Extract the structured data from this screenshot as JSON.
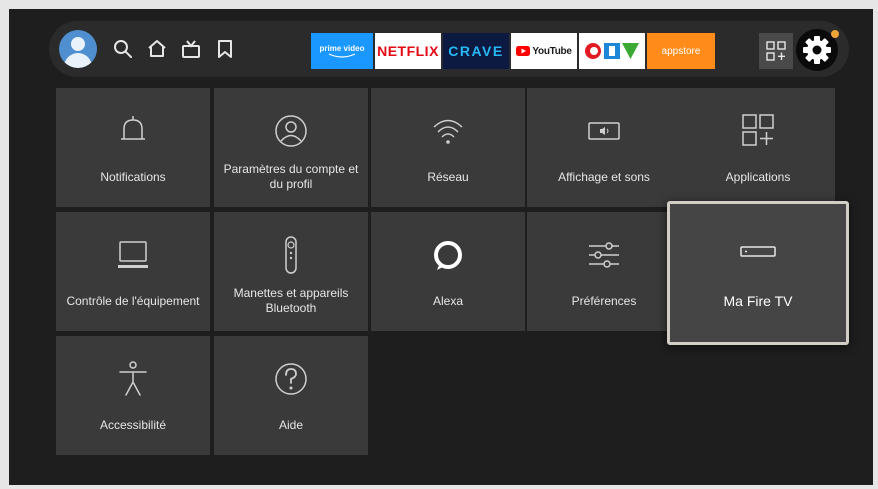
{
  "top_bar": {
    "apps": [
      {
        "id": "prime-video",
        "label": "prime video",
        "bg": "#1a98ff",
        "fg": "#ffffff"
      },
      {
        "id": "netflix",
        "label": "NETFLIX",
        "bg": "#ffffff",
        "fg": "#e50914"
      },
      {
        "id": "crave",
        "label": "CRAVE",
        "bg": "#0c1a42",
        "fg": "#27b7f4"
      },
      {
        "id": "youtube",
        "label": "YouTube",
        "bg": "#ffffff",
        "fg": "#1a1a1a"
      },
      {
        "id": "ctv",
        "label": "CTV",
        "bg": "#ffffff",
        "fg": "#e21b22"
      },
      {
        "id": "appstore",
        "label": "appstore",
        "bg": "#ff8c1a",
        "fg": "#ffffff"
      }
    ]
  },
  "settings": {
    "tiles": [
      {
        "label": "Notifications",
        "icon": "bell-icon"
      },
      {
        "label": "Paramètres du compte et du profil",
        "icon": "user-circle-icon"
      },
      {
        "label": "Réseau",
        "icon": "wifi-icon"
      },
      {
        "label": "Affichage et sons",
        "icon": "display-sound-icon"
      },
      {
        "label": "Applications",
        "icon": "apps-icon"
      },
      {
        "label": "Contrôle de l'équipement",
        "icon": "tv-icon"
      },
      {
        "label": "Manettes et appareils Bluetooth",
        "icon": "remote-icon"
      },
      {
        "label": "Alexa",
        "icon": "alexa-icon"
      },
      {
        "label": "Préférences",
        "icon": "sliders-icon"
      },
      {
        "label": "Ma Fire TV",
        "icon": "fire-tv-device-icon"
      },
      {
        "label": "Accessibilité",
        "icon": "accessibility-icon"
      },
      {
        "label": "Aide",
        "icon": "help-icon"
      }
    ]
  }
}
